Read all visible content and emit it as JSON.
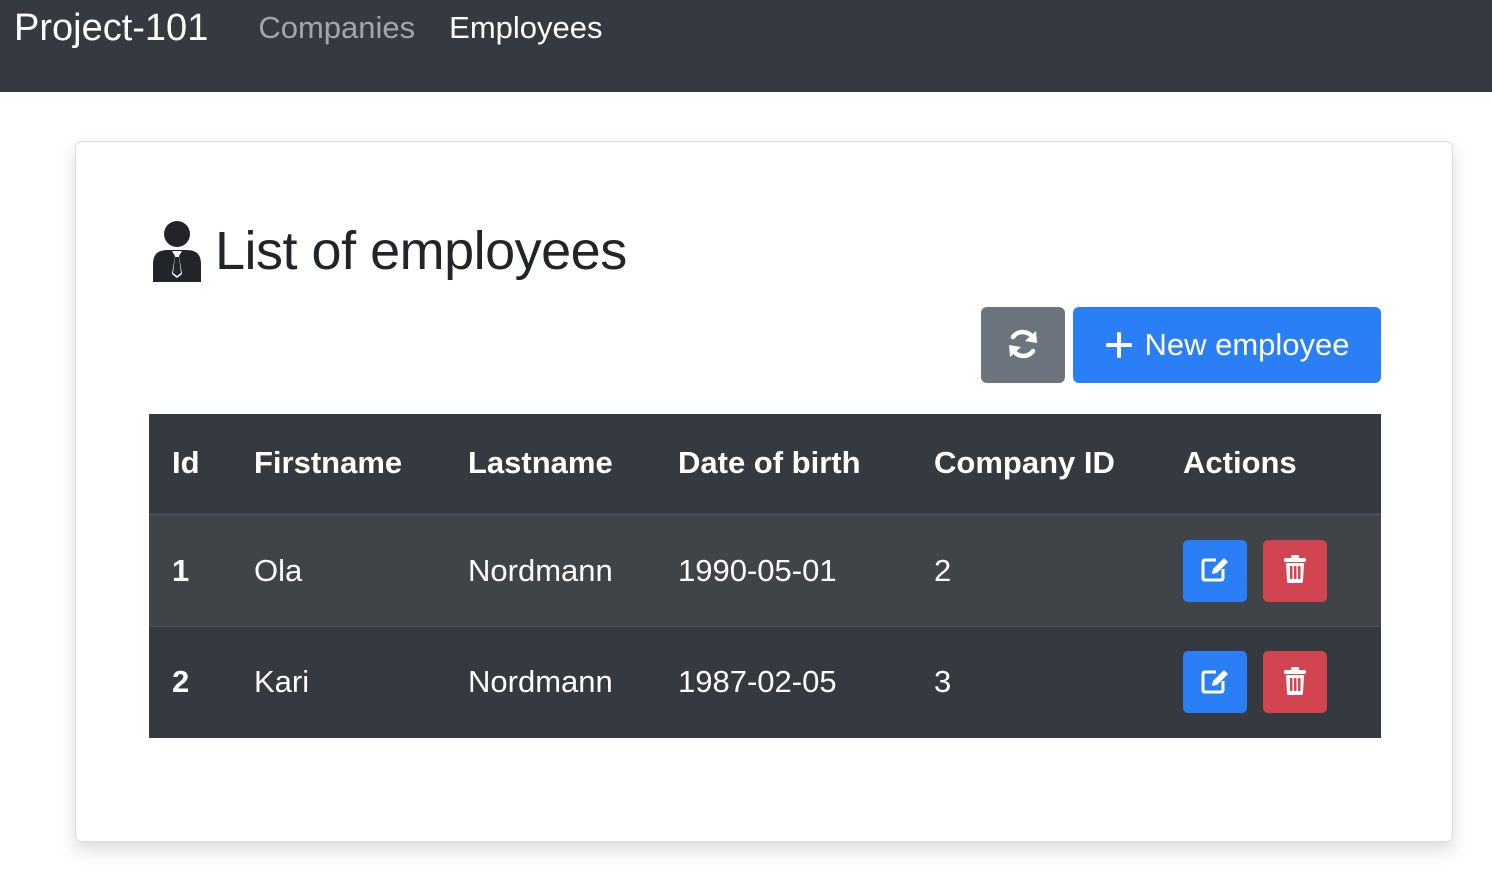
{
  "navbar": {
    "brand": "Project-101",
    "links": [
      {
        "label": "Companies",
        "active": false
      },
      {
        "label": "Employees",
        "active": true
      }
    ]
  },
  "page": {
    "title": "List of employees",
    "title_icon": "person-tie-icon"
  },
  "toolbar": {
    "refresh_icon": "refresh-icon",
    "new_label": "New employee",
    "new_icon": "plus-icon"
  },
  "table": {
    "headers": [
      "Id",
      "Firstname",
      "Lastname",
      "Date of birth",
      "Company ID",
      "Actions"
    ],
    "rows": [
      {
        "id": "1",
        "firstname": "Ola",
        "lastname": "Nordmann",
        "dob": "1990-05-01",
        "company_id": "2"
      },
      {
        "id": "2",
        "firstname": "Kari",
        "lastname": "Nordmann",
        "dob": "1987-02-05",
        "company_id": "3"
      }
    ],
    "row_actions": [
      "edit-icon",
      "trash-icon"
    ]
  },
  "colors": {
    "navbar": "#343a40",
    "primary": "#2b7ff6",
    "secondary": "#6c757d",
    "danger": "#d2444f"
  }
}
